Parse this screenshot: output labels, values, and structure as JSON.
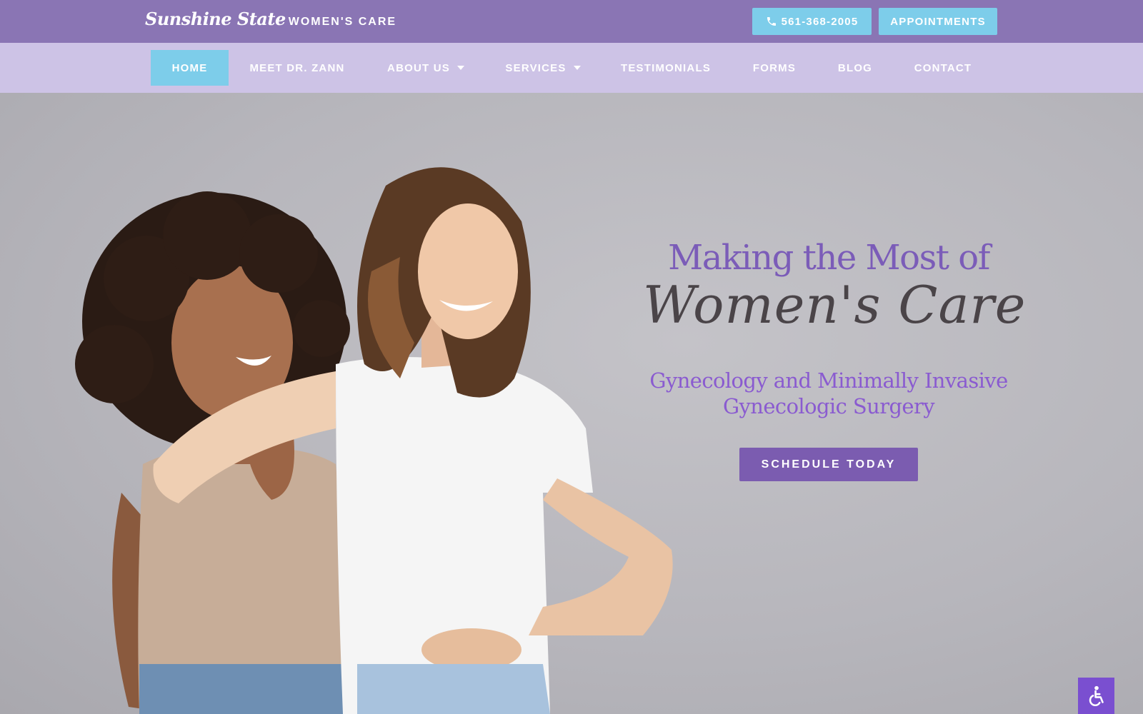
{
  "header": {
    "logo_script": "Sunshine State",
    "logo_caps": "WOMEN'S CARE",
    "phone_label": "561-368-2005",
    "appointments_label": "APPOINTMENTS"
  },
  "nav": {
    "items": [
      {
        "label": "HOME",
        "active": true
      },
      {
        "label": "MEET DR. ZANN"
      },
      {
        "label": "ABOUT US",
        "dropdown": true
      },
      {
        "label": "SERVICES",
        "dropdown": true
      },
      {
        "label": "TESTIMONIALS"
      },
      {
        "label": "FORMS"
      },
      {
        "label": "BLOG"
      },
      {
        "label": "CONTACT"
      }
    ]
  },
  "hero": {
    "title_line1": "Making the Most of",
    "title_line2": "Women's Care",
    "subtitle_line1": "Gynecology and Minimally Invasive",
    "subtitle_line2": "Gynecologic Surgery",
    "cta_label": "SCHEDULE TODAY"
  },
  "icons": {
    "phone": "phone-icon",
    "accessibility": "wheelchair-icon",
    "dropdown": "caret-down-icon"
  },
  "colors": {
    "topbar": "#8a75b4",
    "navbar": "#cdc3e6",
    "accent_blue": "#7dcdea",
    "purple_title": "#7b5cb8",
    "purple_button": "#7b5cb0",
    "accessibility": "#7a4fd0"
  }
}
